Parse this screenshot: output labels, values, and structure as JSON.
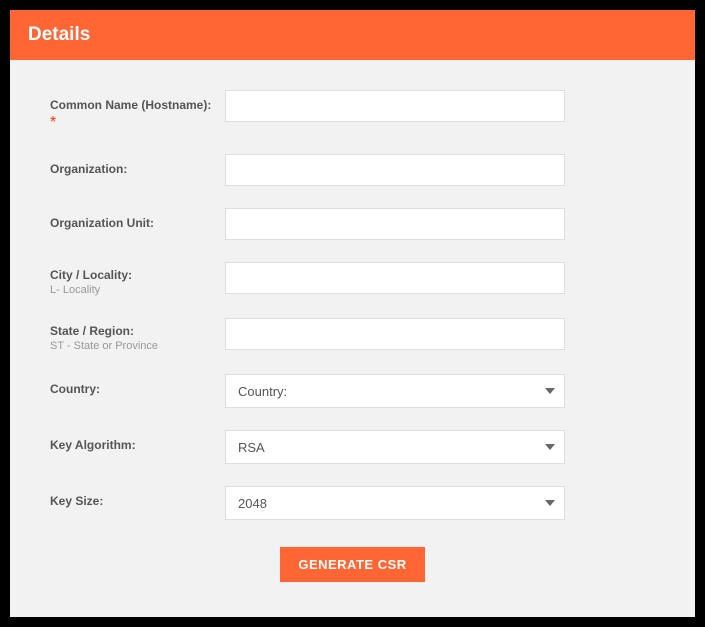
{
  "header": {
    "title": "Details"
  },
  "fields": {
    "common_name": {
      "label": "Common Name (Hostname):",
      "required_mark": "*",
      "value": ""
    },
    "organization": {
      "label": "Organization:",
      "value": ""
    },
    "org_unit": {
      "label": "Organization Unit:",
      "value": ""
    },
    "city": {
      "label": "City / Locality:",
      "hint": "L- Locality",
      "value": ""
    },
    "state": {
      "label": "State / Region:",
      "hint": "ST - State or Province",
      "value": ""
    },
    "country": {
      "label": "Country:",
      "selected": "Country:"
    },
    "key_algo": {
      "label": "Key Algorithm:",
      "selected": "RSA"
    },
    "key_size": {
      "label": "Key Size:",
      "selected": "2048"
    }
  },
  "buttons": {
    "generate": "GENERATE CSR"
  }
}
